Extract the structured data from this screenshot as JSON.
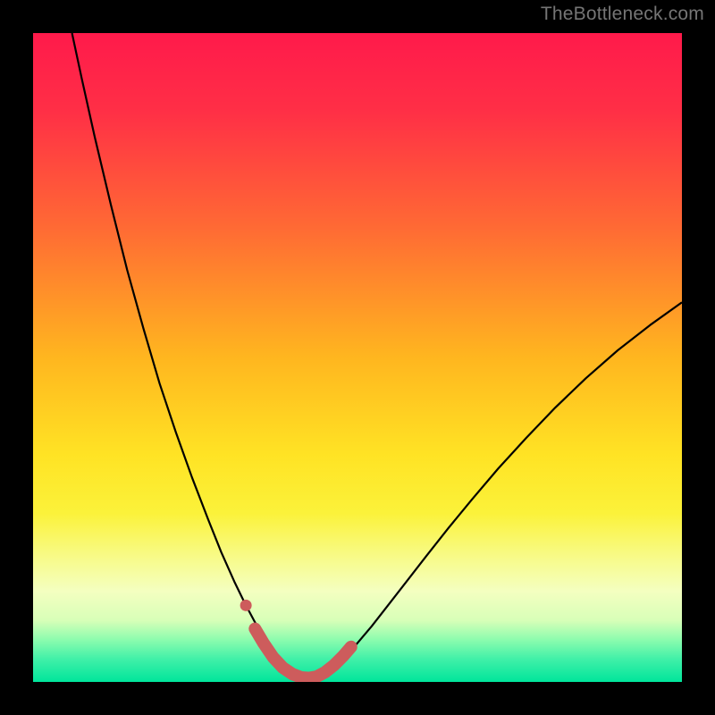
{
  "watermark": "TheBottleneck.com",
  "chart_data": {
    "type": "line",
    "title": "",
    "xlabel": "",
    "ylabel": "",
    "xlim": [
      0,
      100
    ],
    "ylim": [
      0,
      100
    ],
    "gradient_stops": [
      {
        "offset": 0.0,
        "color": "#ff1a4b"
      },
      {
        "offset": 0.12,
        "color": "#ff2f46"
      },
      {
        "offset": 0.3,
        "color": "#ff6a34"
      },
      {
        "offset": 0.5,
        "color": "#ffb61f"
      },
      {
        "offset": 0.65,
        "color": "#ffe324"
      },
      {
        "offset": 0.74,
        "color": "#fbf23a"
      },
      {
        "offset": 0.8,
        "color": "#f8fa80"
      },
      {
        "offset": 0.86,
        "color": "#f4ffc0"
      },
      {
        "offset": 0.905,
        "color": "#d8ffb8"
      },
      {
        "offset": 0.935,
        "color": "#8cfcae"
      },
      {
        "offset": 0.965,
        "color": "#40f0a8"
      },
      {
        "offset": 1.0,
        "color": "#00e59b"
      }
    ],
    "series": [
      {
        "name": "black-curve",
        "color": "#000000",
        "width": 2.2,
        "points": [
          {
            "x": 6.0,
            "y": 100.0
          },
          {
            "x": 7.5,
            "y": 93.0
          },
          {
            "x": 9.5,
            "y": 84.0
          },
          {
            "x": 12.0,
            "y": 73.5
          },
          {
            "x": 14.5,
            "y": 63.5
          },
          {
            "x": 17.0,
            "y": 54.5
          },
          {
            "x": 19.5,
            "y": 46.0
          },
          {
            "x": 22.0,
            "y": 38.5
          },
          {
            "x": 24.5,
            "y": 31.5
          },
          {
            "x": 27.0,
            "y": 25.0
          },
          {
            "x": 29.0,
            "y": 20.0
          },
          {
            "x": 31.0,
            "y": 15.5
          },
          {
            "x": 32.7,
            "y": 12.0
          },
          {
            "x": 34.2,
            "y": 9.2
          },
          {
            "x": 35.5,
            "y": 7.0
          },
          {
            "x": 36.7,
            "y": 5.2
          },
          {
            "x": 37.8,
            "y": 3.8
          },
          {
            "x": 38.8,
            "y": 2.7
          },
          {
            "x": 39.8,
            "y": 1.9
          },
          {
            "x": 40.7,
            "y": 1.3
          },
          {
            "x": 41.6,
            "y": 0.9
          },
          {
            "x": 42.5,
            "y": 0.7
          },
          {
            "x": 43.3,
            "y": 0.7
          },
          {
            "x": 44.2,
            "y": 1.0
          },
          {
            "x": 45.3,
            "y": 1.6
          },
          {
            "x": 46.6,
            "y": 2.6
          },
          {
            "x": 48.2,
            "y": 4.1
          },
          {
            "x": 50.0,
            "y": 6.0
          },
          {
            "x": 52.2,
            "y": 8.6
          },
          {
            "x": 54.7,
            "y": 11.8
          },
          {
            "x": 57.5,
            "y": 15.4
          },
          {
            "x": 60.6,
            "y": 19.4
          },
          {
            "x": 64.0,
            "y": 23.7
          },
          {
            "x": 67.7,
            "y": 28.2
          },
          {
            "x": 71.7,
            "y": 32.9
          },
          {
            "x": 76.0,
            "y": 37.6
          },
          {
            "x": 80.5,
            "y": 42.3
          },
          {
            "x": 85.2,
            "y": 46.8
          },
          {
            "x": 90.1,
            "y": 51.1
          },
          {
            "x": 95.1,
            "y": 55.0
          },
          {
            "x": 100.0,
            "y": 58.5
          }
        ]
      },
      {
        "name": "highlight-segment",
        "color": "#cd5c5c",
        "width": 14,
        "linecap": "round",
        "points": [
          {
            "x": 34.2,
            "y": 8.2
          },
          {
            "x": 35.5,
            "y": 6.0
          },
          {
            "x": 37.0,
            "y": 3.8
          },
          {
            "x": 38.5,
            "y": 2.2
          },
          {
            "x": 40.0,
            "y": 1.2
          },
          {
            "x": 41.3,
            "y": 0.7
          },
          {
            "x": 42.5,
            "y": 0.6
          },
          {
            "x": 43.7,
            "y": 0.8
          },
          {
            "x": 45.0,
            "y": 1.5
          },
          {
            "x": 46.4,
            "y": 2.6
          },
          {
            "x": 47.8,
            "y": 4.0
          },
          {
            "x": 49.0,
            "y": 5.4
          }
        ]
      }
    ],
    "markers": [
      {
        "name": "highlight-dot",
        "x": 32.8,
        "y": 11.8,
        "r": 6.5,
        "color": "#cd5c5c"
      }
    ]
  }
}
